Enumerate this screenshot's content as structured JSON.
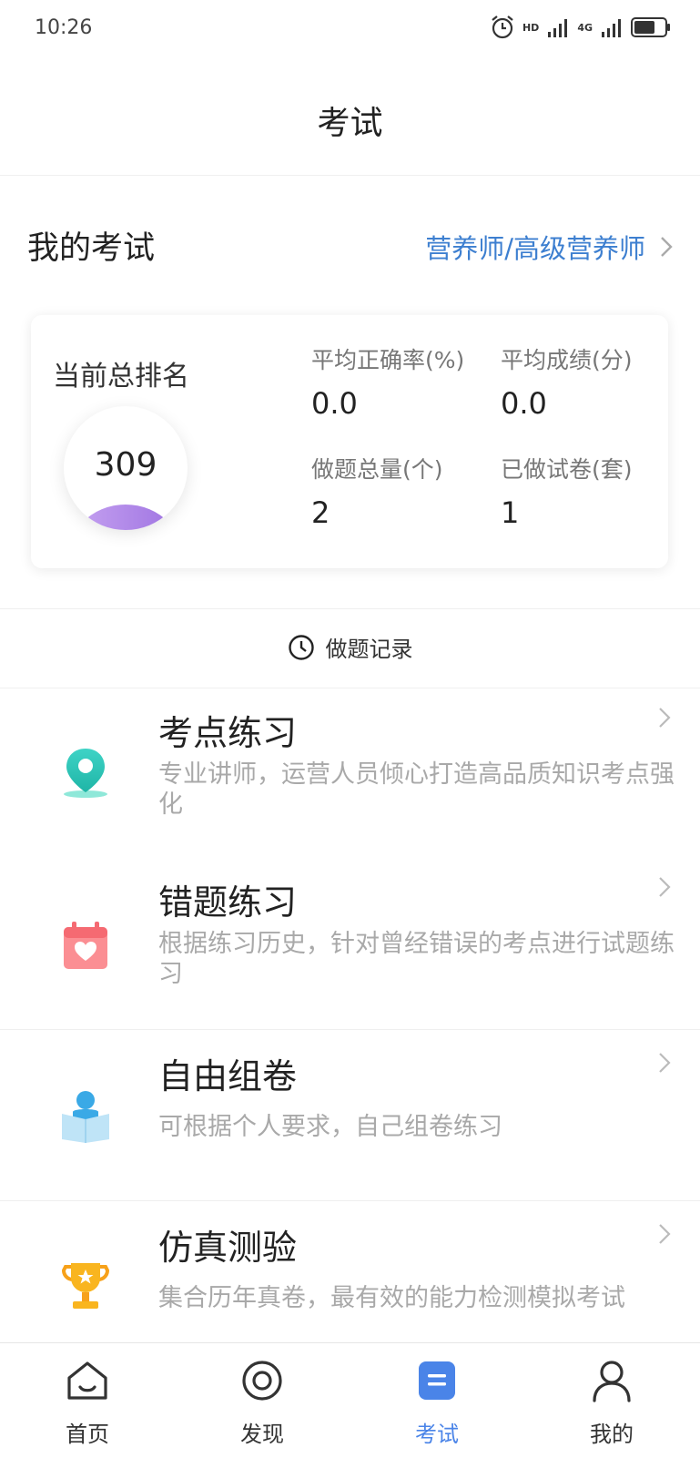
{
  "status_bar": {
    "time": "10:26",
    "network_1": "4G",
    "network_2": "4G",
    "hd": "HD"
  },
  "header": {
    "title": "考试"
  },
  "my_exam": {
    "title": "我的考试",
    "profession": "营养师/高级营养师",
    "rank_label": "当前总排名",
    "rank_value": "309",
    "stats": [
      {
        "label": "平均正确率(%)",
        "value": "0.0"
      },
      {
        "label": "平均成绩(分)",
        "value": "0.0"
      },
      {
        "label": "做题总量(个)",
        "value": "2"
      },
      {
        "label": "已做试卷(套)",
        "value": "1"
      }
    ]
  },
  "record": {
    "label": "做题记录"
  },
  "features": [
    {
      "title": "考点练习",
      "desc": "专业讲师，运营人员倾心打造高品质知识考点强化",
      "icon": "location-pin-icon"
    },
    {
      "title": "错题练习",
      "desc": "根据练习历史，针对曾经错误的考点进行试题练习",
      "icon": "calendar-heart-icon"
    },
    {
      "title": "自由组卷",
      "desc": "可根据个人要求，自己组卷练习",
      "icon": "reader-book-icon"
    },
    {
      "title": "仿真测验",
      "desc": "集合历年真卷，最有效的能力检测模拟考试",
      "icon": "trophy-icon"
    }
  ],
  "nav": {
    "items": [
      {
        "label": "首页",
        "icon": "home-icon"
      },
      {
        "label": "发现",
        "icon": "discover-icon"
      },
      {
        "label": "考试",
        "icon": "exam-icon"
      },
      {
        "label": "我的",
        "icon": "profile-icon"
      }
    ],
    "active": "考试"
  },
  "colors": {
    "accent": "#4a84e8",
    "link": "#3d7fd0",
    "muted": "#a9a9a9"
  }
}
